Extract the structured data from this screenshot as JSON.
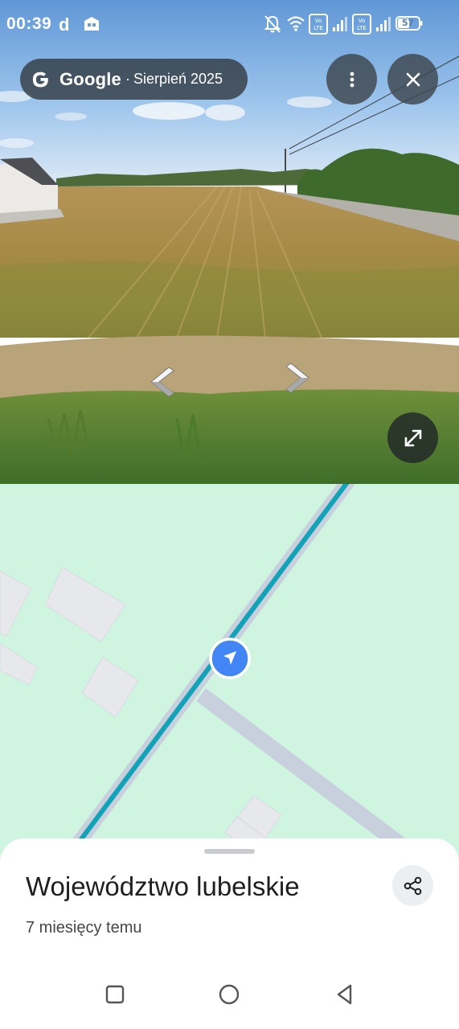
{
  "status_bar": {
    "time": "00:39",
    "notification_icons": [
      "carrier-d-icon",
      "app-notification-icon"
    ],
    "system_icons": [
      "bell-off-icon",
      "wifi-icon",
      "volte-icon",
      "signal-icon",
      "volte-icon",
      "signal-icon",
      "battery-icon"
    ],
    "battery_level": "57"
  },
  "street_view": {
    "brand": "Google",
    "separator": "·",
    "capture_date": "Sierpień 2025",
    "menu_icon": "more-vertical-icon",
    "close_icon": "close-icon",
    "nav_arrows": [
      "arrow-left-icon",
      "arrow-right-icon"
    ],
    "expand_icon": "expand-icon"
  },
  "map": {
    "background_color": "#cff5e0",
    "road_color": "#c7d0dc",
    "route_color": "#13a3b8",
    "location_marker": "location-arrow-icon",
    "marker_color": "#4285f4"
  },
  "place_sheet": {
    "title": "Województwo lubelskie",
    "subtitle": "7 miesięcy temu",
    "share_icon": "share-icon"
  },
  "nav_bar": {
    "buttons": [
      "recents-square-icon",
      "home-circle-icon",
      "back-triangle-icon"
    ]
  }
}
